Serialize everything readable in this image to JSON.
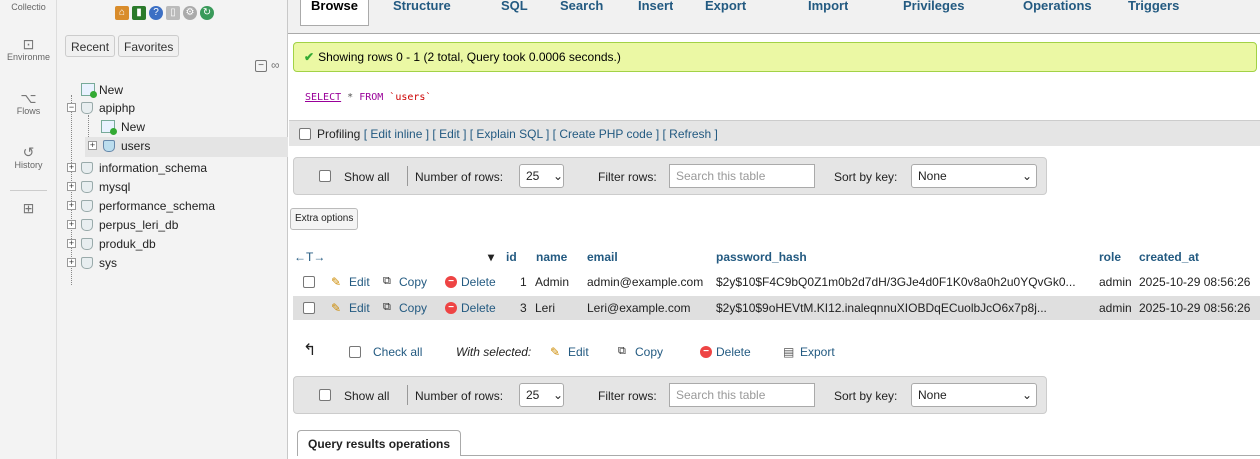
{
  "rail": {
    "items": [
      {
        "label": "Collectio",
        "icon": "collection-icon"
      },
      {
        "label": "Environme",
        "icon": "environment-icon"
      },
      {
        "label": "Flows",
        "icon": "flows-icon"
      },
      {
        "label": "History",
        "icon": "history-icon"
      },
      {
        "label": "",
        "icon": "add-icon"
      }
    ]
  },
  "nav": {
    "tabs": [
      "Recent",
      "Favorites"
    ],
    "tree": [
      {
        "label": "New"
      },
      {
        "label": "apiphp"
      },
      {
        "label": "New"
      },
      {
        "label": "users"
      },
      {
        "label": "information_schema"
      },
      {
        "label": "mysql"
      },
      {
        "label": "performance_schema"
      },
      {
        "label": "perpus_leri_db"
      },
      {
        "label": "produk_db"
      },
      {
        "label": "sys"
      }
    ]
  },
  "tabs": [
    "Browse",
    "Structure",
    "SQL",
    "Search",
    "Insert",
    "Export",
    "Import",
    "Privileges",
    "Operations",
    "Triggers"
  ],
  "success": "Showing rows 0 - 1 (2 total, Query took 0.0006 seconds.)",
  "sql": {
    "select": "SELECT",
    "star": " * ",
    "from": "FROM ",
    "table": "`users`"
  },
  "profiling": {
    "label": "Profiling",
    "links": "[ Edit inline ] [ Edit ] [ Explain SQL ] [ Create PHP code ] [ Refresh ]"
  },
  "navbar": {
    "show_all": "Show all",
    "rows_label": "Number of rows:",
    "rows_value": "25",
    "filter_label": "Filter rows:",
    "filter_placeholder": "Search this table",
    "sort_label": "Sort by key:",
    "sort_value": "None"
  },
  "extra_options": "Extra options",
  "table": {
    "arrows": "←T→",
    "columns": [
      "id",
      "name",
      "email",
      "password_hash",
      "role",
      "created_at"
    ],
    "rows": [
      {
        "id": "1",
        "name": "Admin",
        "email": "admin@example.com",
        "hash": "$2y$10$F4C9bQ0Z1m0b2d7dH/3GJe4d0F1K0v8a0h2u0YQvGk0...",
        "role": "admin",
        "created": "2025-10-29 08:56:26"
      },
      {
        "id": "3",
        "name": "Leri",
        "email": "Leri@example.com",
        "hash": "$2y$10$9oHEVtM.KI12.inaleqnnuXIOBDqECuolbJcO6x7p8j...",
        "role": "admin",
        "created": "2025-10-29 08:56:26"
      }
    ],
    "actions": {
      "edit": "Edit",
      "copy": "Copy",
      "delete": "Delete"
    }
  },
  "bulk": {
    "check_all": "Check all",
    "with_selected": "With selected:",
    "edit": "Edit",
    "copy": "Copy",
    "delete": "Delete",
    "export": "Export"
  },
  "qro": "Query results operations"
}
